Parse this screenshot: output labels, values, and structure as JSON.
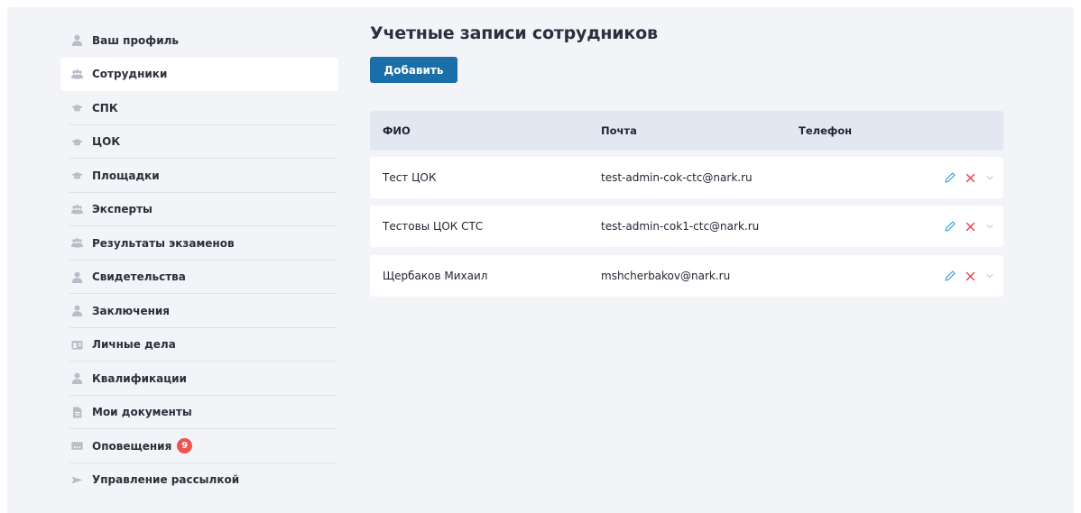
{
  "sidebar": {
    "items": [
      {
        "label": "Ваш профиль",
        "icon": "user-icon"
      },
      {
        "label": "Сотрудники",
        "icon": "users-icon",
        "active": true
      },
      {
        "label": "СПК",
        "icon": "graduation-cap-icon"
      },
      {
        "label": "ЦОК",
        "icon": "graduation-cap-icon"
      },
      {
        "label": "Площадки",
        "icon": "graduation-cap-icon"
      },
      {
        "label": "Эксперты",
        "icon": "users-icon"
      },
      {
        "label": "Результаты экзаменов",
        "icon": "users-icon"
      },
      {
        "label": "Свидетельства",
        "icon": "user-icon"
      },
      {
        "label": "Заключения",
        "icon": "user-icon"
      },
      {
        "label": "Личные дела",
        "icon": "id-card-icon"
      },
      {
        "label": "Квалификации",
        "icon": "user-icon"
      },
      {
        "label": "Мои документы",
        "icon": "document-icon"
      },
      {
        "label": "Оповещения",
        "icon": "message-icon",
        "badge": "9"
      },
      {
        "label": "Управление рассылкой",
        "icon": "send-icon"
      }
    ]
  },
  "main": {
    "title": "Учетные записи сотрудников",
    "add_label": "Добавить",
    "table": {
      "columns": {
        "name": "ФИО",
        "email": "Почта",
        "phone": "Телефон"
      },
      "rows": [
        {
          "name": "Тест ЦОК",
          "email": "test-admin-cok-ctc@nark.ru",
          "phone": ""
        },
        {
          "name": "Тестовы ЦОК СТС",
          "email": "test-admin-cok1-ctc@nark.ru",
          "phone": ""
        },
        {
          "name": "Щербаков Михаил",
          "email": "mshcherbakov@nark.ru",
          "phone": ""
        }
      ]
    }
  },
  "colors": {
    "accent": "#1b6fa8",
    "badge": "#f0524f",
    "edit": "#2aa0d8",
    "delete": "#e53b4a",
    "icon": "#b8bec8"
  }
}
